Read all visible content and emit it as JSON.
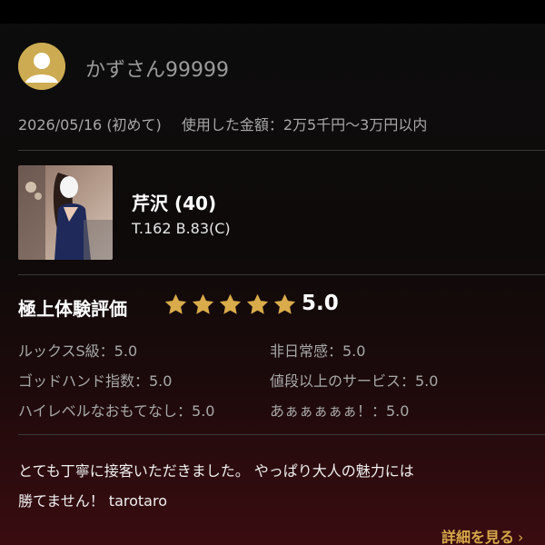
{
  "reviewer": {
    "name": "かずさん99999"
  },
  "visit": {
    "date": "2026/05/16",
    "visit_type": "(初めて)",
    "amount_text": "使用した金額：2万5千円〜3万円以内"
  },
  "girl": {
    "name": "芹沢",
    "age": "(40)",
    "stats": "T.162 B.83(C)"
  },
  "rating": {
    "title": "極上体験評価",
    "stars": 5,
    "max_stars": 5,
    "score": "5.0",
    "star_color": "#d9ab4a"
  },
  "criteria": [
    {
      "label": "ルックスS級：5.0"
    },
    {
      "label": "非日常感：5.0"
    },
    {
      "label": "ゴッドハンド指数：5.0"
    },
    {
      "label": "値段以上のサービス：5.0"
    },
    {
      "label": "ハイレベルなおもてなし：5.0"
    },
    {
      "label": "あぁぁぁぁぁ！：5.0"
    }
  ],
  "comment": {
    "line1": "とても丁寧に接客いただきました。 やっぱり大人の魅力には",
    "line2": "勝てません！ tarotaro"
  },
  "details": {
    "label": "詳細を見る",
    "chevron": "›"
  },
  "colors": {
    "accent_gold": "#d8a94a",
    "avatar_bg": "#ccab52"
  }
}
